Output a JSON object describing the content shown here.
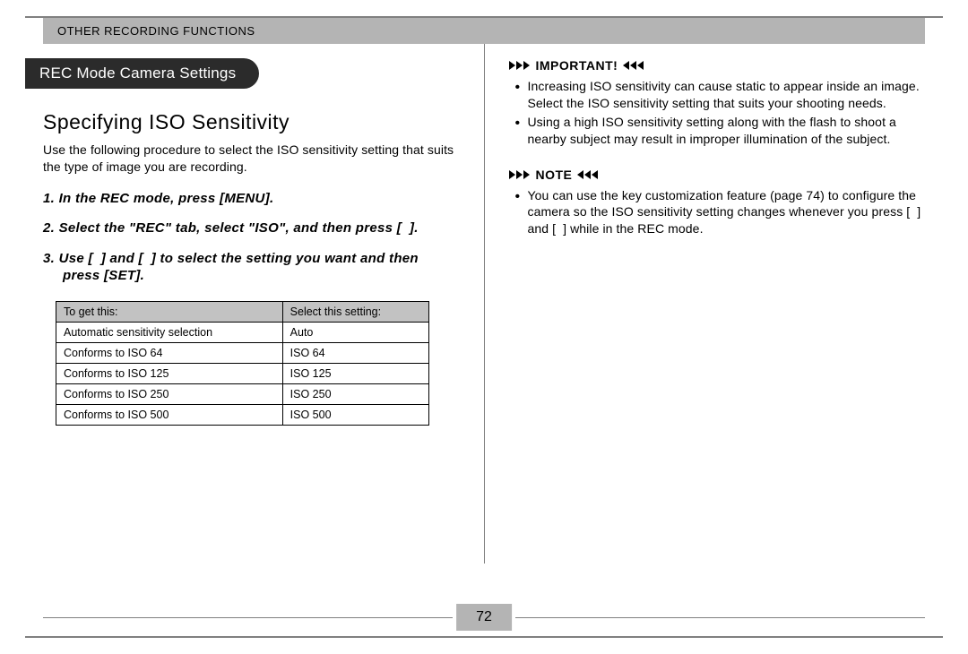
{
  "header": {
    "title": "OTHER RECORDING FUNCTIONS"
  },
  "left": {
    "pill": "REC Mode Camera Settings",
    "title": "Specifying ISO Sensitivity",
    "intro": "Use the following procedure to select the ISO sensitivity setting that suits the type of image you are recording.",
    "steps": [
      "In the REC mode, press [MENU].",
      "Select the \"REC\" tab, select \"ISO\", and then press [  ].",
      "Use [  ] and [  ] to select the setting you want and then press [SET]."
    ],
    "table": {
      "headers": [
        "To get this:",
        "Select this setting:"
      ],
      "rows": [
        [
          "Automatic sensitivity selection",
          "Auto"
        ],
        [
          "Conforms to ISO 64",
          "ISO 64"
        ],
        [
          "Conforms to ISO 125",
          "ISO 125"
        ],
        [
          "Conforms to ISO 250",
          "ISO 250"
        ],
        [
          "Conforms to ISO 500",
          "ISO 500"
        ]
      ]
    }
  },
  "right": {
    "important_label": "IMPORTANT!",
    "important_items": [
      "Increasing ISO sensitivity can cause static to appear inside an image. Select the ISO sensitivity setting that suits your shooting needs.",
      "Using a high ISO sensitivity setting along with the flash to shoot a nearby subject may result in improper illumination of the subject."
    ],
    "note_label": "NOTE",
    "note_items": [
      "You can use the key customization feature (page 74) to configure the camera so the ISO sensitivity setting changes whenever you press [  ] and [  ] while in the REC mode."
    ]
  },
  "page_number": "72"
}
